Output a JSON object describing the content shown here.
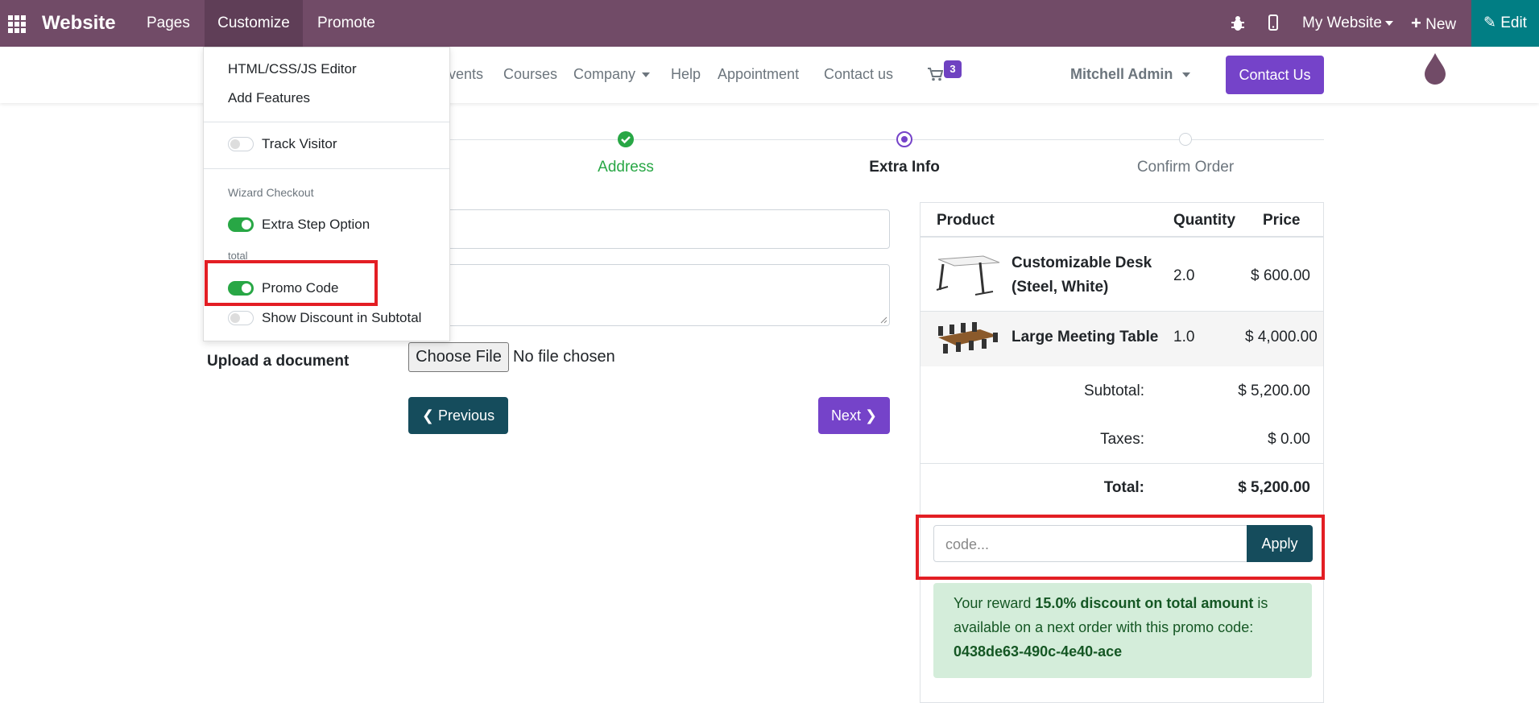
{
  "topbar": {
    "brand": "Website",
    "menu": [
      "Pages",
      "Customize",
      "Promote"
    ],
    "website_selector": "My Website",
    "new_label": "New",
    "edit_label": "Edit"
  },
  "navbar": {
    "items": [
      "Events",
      "Courses",
      "Company",
      "Help",
      "Appointment",
      "Contact us"
    ],
    "cart_count": "3",
    "user": "Mitchell Admin",
    "contact_button": "Contact Us"
  },
  "customize_menu": {
    "html_editor": "HTML/CSS/JS Editor",
    "add_features": "Add Features",
    "track_visitor": "Track Visitor",
    "wizard_header": "Wizard Checkout",
    "extra_step": "Extra Step Option",
    "total_header": "total",
    "promo_code": "Promo Code",
    "show_discount": "Show Discount in Subtotal"
  },
  "steps": {
    "address": "Address",
    "extra_info": "Extra Info",
    "confirm": "Confirm Order"
  },
  "form": {
    "upload_label": "Upload a document",
    "choose_file": "Choose File",
    "no_file": "No file chosen",
    "previous": "Previous",
    "next": "Next"
  },
  "summary": {
    "headers": {
      "product": "Product",
      "quantity": "Quantity",
      "price": "Price"
    },
    "rows": [
      {
        "name_line1": "Customizable Desk",
        "name_line2": "(Steel, White)",
        "qty": "2.0",
        "price": "$ 600.00"
      },
      {
        "name": "Large Meeting Table",
        "qty": "1.0",
        "price": "$ 4,000.00"
      }
    ],
    "subtotal_label": "Subtotal:",
    "subtotal_value": "$ 5,200.00",
    "taxes_label": "Taxes:",
    "taxes_value": "$ 0.00",
    "total_label": "Total:",
    "total_value": "$ 5,200.00",
    "promo_placeholder": "code...",
    "apply": "Apply",
    "reward_prefix": "Your reward ",
    "reward_bold": "15.0% discount on total amount",
    "reward_suffix": " is available on a next order with this promo code:",
    "reward_code": "0438de63-490c-4e40-ace"
  },
  "colors": {
    "topbar": "#714B67",
    "edit": "#017E84",
    "primary": "#7543c9",
    "dark_button": "#154c5c",
    "highlight": "#e31e24"
  }
}
